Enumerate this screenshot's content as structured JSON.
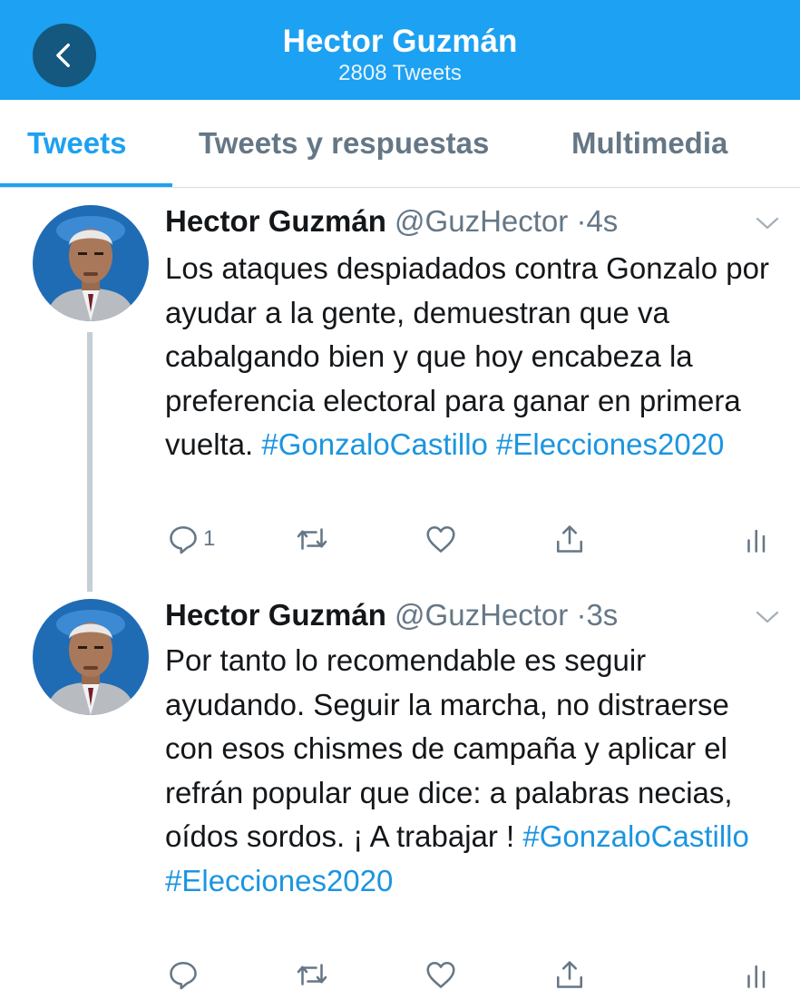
{
  "header": {
    "title": "Hector Guzmán",
    "subtitle": "2808 Tweets",
    "back_icon": "chevron-left-icon",
    "color": "#1da1f2"
  },
  "tabs": [
    {
      "label": "Tweets",
      "active": true
    },
    {
      "label": "Tweets y respuestas",
      "active": false
    },
    {
      "label": "Multimedia",
      "active": false
    }
  ],
  "tweets": [
    {
      "name": "Hector Guzmán",
      "handle": "@GuzHector",
      "separator": "·",
      "time": "4s",
      "text": "Los ataques despiadados contra Gonzalo por ayudar a la gente, demuestran que va cabalgando bien y que hoy encabeza la preferencia electoral para ganar en primera vuelta.",
      "hashtag_1": "#GonzaloCastillo",
      "hashtag_2": "#Elecciones2020",
      "reply_count": "1"
    },
    {
      "name": "Hector Guzmán",
      "handle": "@GuzHector",
      "separator": "·",
      "time": "3s",
      "text": "Por tanto lo recomendable es seguir ayudando. Seguir la marcha, no distraerse con esos chismes de campaña y aplicar el refrán popular que dice: a palabras necias, oídos sordos. ¡ A trabajar !",
      "hashtag_1": "#GonzaloCastillo",
      "hashtag_2": "#Elecciones2020",
      "reply_count": ""
    }
  ]
}
